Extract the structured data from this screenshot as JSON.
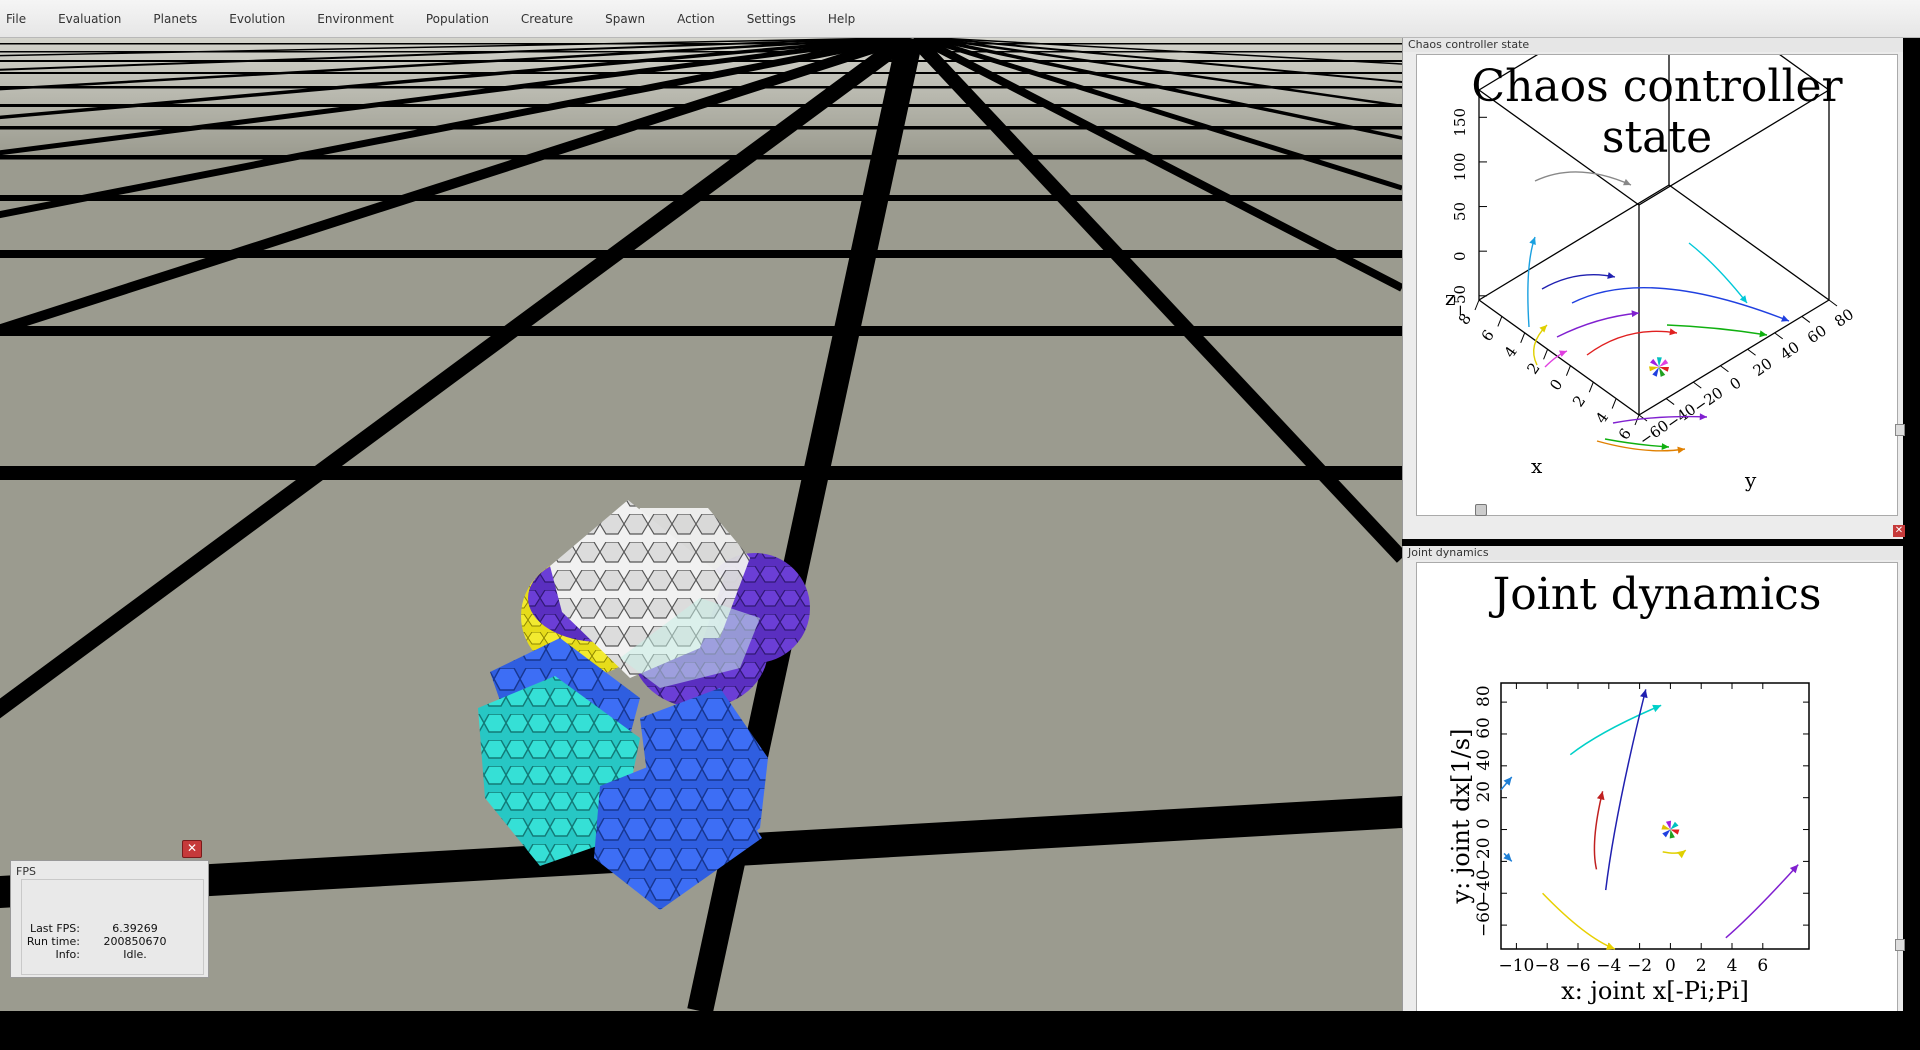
{
  "menu": [
    "File",
    "Evaluation",
    "Planets",
    "Evolution",
    "Environment",
    "Population",
    "Creature",
    "Spawn",
    "Action",
    "Settings",
    "Help"
  ],
  "chaos_panel": {
    "window_title": "Chaos controller state",
    "chart_data": {
      "type": "line3d",
      "title": "Chaos controller state",
      "xlabel": "x",
      "ylabel": "y",
      "zlabel": "z",
      "x_ticks": [
        "8",
        "6",
        "4",
        "2",
        "0",
        "2",
        "4",
        "6"
      ],
      "y_ticks": [
        "-60",
        "-40",
        "-20",
        "0",
        "20",
        "40",
        "60",
        "80"
      ],
      "z_ticks": [
        "150",
        "100",
        "50",
        "0",
        "-50"
      ]
    }
  },
  "joint_panel": {
    "window_title": "Joint dynamics",
    "chart_data": {
      "type": "line",
      "title": "Joint dynamics",
      "xlabel": "x: joint x[-Pi;Pi]",
      "ylabel": "y: joint dx[1/s]",
      "xlim": [
        -11,
        9
      ],
      "ylim": [
        -75,
        92
      ],
      "x_ticks": [
        -10,
        -8,
        -6,
        -4,
        -2,
        0,
        2,
        4,
        6
      ],
      "y_ticks": [
        -60,
        -40,
        -20,
        0,
        20,
        40,
        60,
        80
      ],
      "series": [
        {
          "color": "#1e7fd6",
          "points": [
            [
              -11,
              25
            ],
            [
              -10.3,
              33
            ]
          ]
        },
        {
          "color": "#1e7fd6",
          "points": [
            [
              -10.8,
              -15
            ],
            [
              -10.3,
              -20
            ]
          ]
        },
        {
          "color": "#00d0c8",
          "points": [
            [
              -6.5,
              47
            ],
            [
              -4.5,
              62
            ],
            [
              -0.6,
              78
            ]
          ]
        },
        {
          "color": "#2020b0",
          "points": [
            [
              -4.2,
              -38
            ],
            [
              -3.6,
              10
            ],
            [
              -1.6,
              88
            ]
          ]
        },
        {
          "color": "#c02020",
          "points": [
            [
              -4.8,
              -25
            ],
            [
              -5.2,
              -8
            ],
            [
              -4.4,
              24
            ]
          ]
        },
        {
          "color": "#e8d000",
          "points": [
            [
              -8.3,
              -40
            ],
            [
              -5.5,
              -68
            ],
            [
              -3.6,
              -75
            ]
          ]
        },
        {
          "color": "#8020d0",
          "points": [
            [
              3.6,
              -68
            ],
            [
              5.5,
              -52
            ],
            [
              8.3,
              -22
            ]
          ]
        },
        {
          "color": "#e0d000",
          "points": [
            [
              -0.5,
              -14
            ],
            [
              0.6,
              -16
            ],
            [
              1,
              -13
            ]
          ]
        }
      ]
    }
  },
  "fps": {
    "title": "FPS",
    "rows": [
      {
        "label": "Last FPS:",
        "value": "6.39269"
      },
      {
        "label": "Run time:",
        "value": "200850670"
      },
      {
        "label": "Info:",
        "value": "Idle."
      }
    ]
  }
}
